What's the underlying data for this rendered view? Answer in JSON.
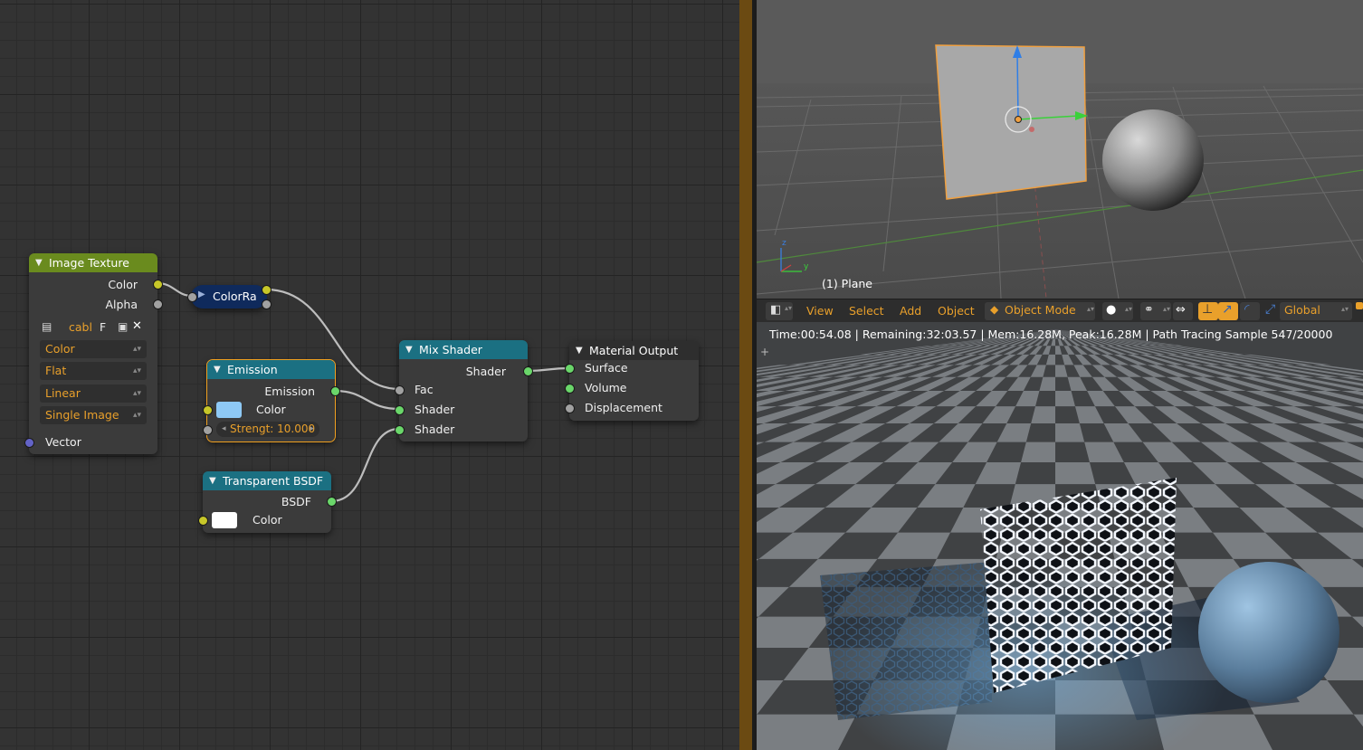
{
  "node_editor": {
    "image_texture": {
      "title": "Image Texture",
      "out_color": "Color",
      "out_alpha": "Alpha",
      "image_name": "cabl",
      "fake_user": "F",
      "color_mode": "Color",
      "projection": "Flat",
      "interpolation": "Linear",
      "source": "Single Image",
      "in_vector": "Vector"
    },
    "color_ramp": {
      "title": "ColorRa"
    },
    "emission": {
      "title": "Emission",
      "out_emission": "Emission",
      "in_color": "Color",
      "strength_field": "Strengt:  10.000",
      "color_swatch": "#8ec9f5"
    },
    "transparent_bsdf": {
      "title": "Transparent BSDF",
      "out_bsdf": "BSDF",
      "in_color": "Color",
      "color_swatch": "#ffffff"
    },
    "mix_shader": {
      "title": "Mix Shader",
      "out_shader": "Shader",
      "in_fac": "Fac",
      "in_shader1": "Shader",
      "in_shader2": "Shader"
    },
    "material_output": {
      "title": "Material Output",
      "in_surface": "Surface",
      "in_volume": "Volume",
      "in_displacement": "Displacement"
    }
  },
  "viewport": {
    "object_label": "(1) Plane",
    "axis_z": "z",
    "axis_y": "y"
  },
  "toolbar": {
    "view": "View",
    "select": "Select",
    "add": "Add",
    "object": "Object",
    "mode": "Object Mode",
    "orientation": "Global"
  },
  "render": {
    "status": "Time:00:54.08 | Remaining:32:03.57 | Mem:16.28M, Peak:16.28M | Path Tracing Sample 547/20000",
    "plus": "+"
  },
  "colors": {
    "node_texture_header": "#6a8b1e",
    "node_shader_header": "#1b7082",
    "selection_outline": "#f0a020",
    "ui_orange_text": "#e9a02b"
  }
}
